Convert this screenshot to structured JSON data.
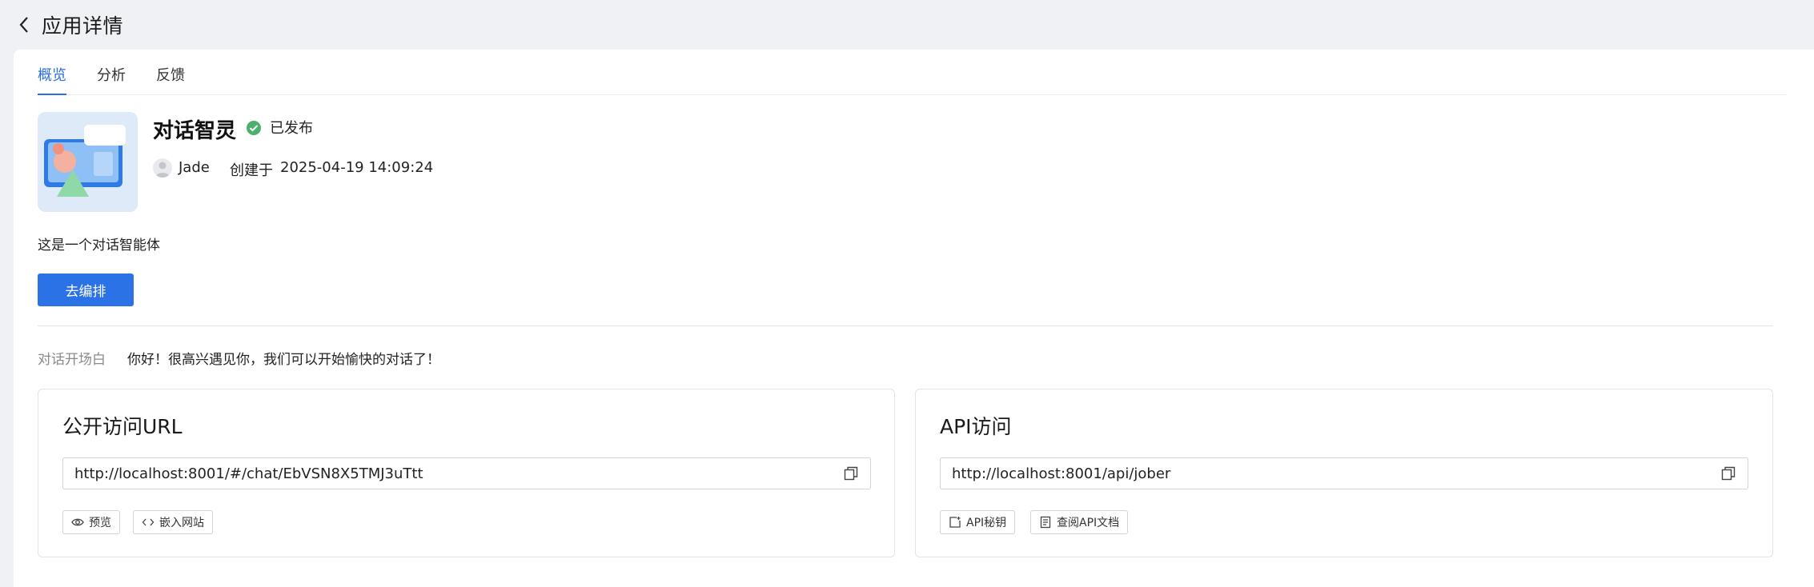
{
  "header": {
    "title": "应用详情",
    "back_icon": "chevron-left-icon"
  },
  "tabs": [
    {
      "label": "概览",
      "active": true
    },
    {
      "label": "分析",
      "active": false
    },
    {
      "label": "反馈",
      "active": false
    }
  ],
  "app": {
    "name": "对话智灵",
    "status": "已发布",
    "status_color": "#4caf6e",
    "author": "Jade",
    "created_label": "创建于",
    "created_time": "2025-04-19 14:09:24",
    "description": "这是一个对话智能体",
    "edit_button": "去编排"
  },
  "opening": {
    "label": "对话开场白",
    "text": "你好！很高兴遇见你，我们可以开始愉快的对话了！"
  },
  "public_url_card": {
    "title": "公开访问URL",
    "url": "http://localhost:8001/#/chat/EbVSN8X5TMJ3uTtt",
    "buttons": [
      {
        "label": "预览",
        "icon": "eye-icon"
      },
      {
        "label": "嵌入网站",
        "icon": "code-icon"
      }
    ]
  },
  "api_card": {
    "title": "API访问",
    "url": "http://localhost:8001/api/jober",
    "buttons": [
      {
        "label": "API秘钥",
        "icon": "key-add-icon"
      },
      {
        "label": "查阅API文档",
        "icon": "document-icon"
      }
    ]
  },
  "colors": {
    "accent": "#2a72e5",
    "background": "#f0f1f5"
  }
}
